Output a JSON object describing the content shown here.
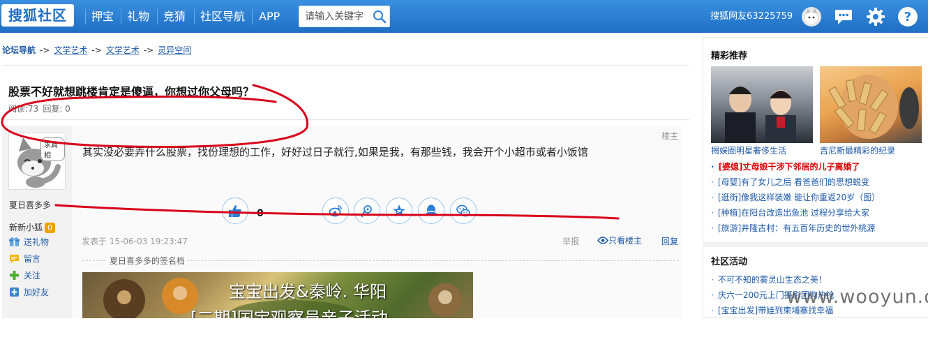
{
  "header": {
    "logo_text": "搜狐社区",
    "nav": [
      {
        "label": "押宝"
      },
      {
        "label": "礼物"
      },
      {
        "label": "竞猜"
      },
      {
        "label": "社区导航"
      },
      {
        "label": "APP"
      }
    ],
    "search_placeholder": "请输入关键字",
    "username": "搜狐网友63225759",
    "brand_color": "#2a7fd6"
  },
  "breadcrumb": {
    "home": "论坛导航",
    "sep": "->",
    "items": [
      "文学艺术",
      "文学艺术",
      "灵异空间"
    ]
  },
  "post": {
    "title": "股票不好就想跳楼肯定是傻逼，你想过你父母吗？",
    "reads_label": "阅读:73",
    "replies_label": "回复: 0",
    "floor_label": "楼主",
    "content": "其实没必要弄什么股票，找份理想的工作，好好过日子就行,如果是我，有那些钱，我会开个小超市或者小饭馆",
    "like_count": "0",
    "time": "发表于 15-06-03 19:23:47",
    "report": "举报",
    "only_op": "只看楼主",
    "reply": "回复",
    "signature_label": "夏日喜多多的签名档",
    "signature_image_line1": "宝宝出发&秦岭. 华阳",
    "signature_image_line2": "[二期]国宝观察员亲子活动"
  },
  "author": {
    "avatar_badge": "求真相",
    "name": "夏日喜多多",
    "level_label": "新新小狐",
    "level_num": "0",
    "actions": [
      {
        "label": "送礼物",
        "icon": "gift-icon"
      },
      {
        "label": "留言",
        "icon": "message-icon"
      },
      {
        "label": "关注",
        "icon": "plus-icon"
      },
      {
        "label": "加好友",
        "icon": "add-friend-icon"
      }
    ]
  },
  "sidebar": {
    "featured_title": "精彩推荐",
    "featured_images": [
      {
        "caption": "揭娱圈明星奢侈生活"
      },
      {
        "caption": "吉尼斯最精彩的纪录"
      }
    ],
    "featured_list": [
      {
        "text": "[婆媳]丈母娘干涉下邻居的儿子离婚了",
        "hot": true
      },
      {
        "text": "[母婴]有了女儿之后 看爸爸们的思想蜕变",
        "hot": false
      },
      {
        "text": "[逛街]像我这样装嫩 能让你重返20岁（图）",
        "hot": false
      },
      {
        "text": "[种植]在阳台改造出鱼池 过程分享给大家",
        "hot": false
      },
      {
        "text": "[旅游]井隆古村：有五百年历史的世外桃源",
        "hot": false
      }
    ],
    "activity_title": "社区活动",
    "activity_list": [
      {
        "text": "不可不知的雾灵山生态之美！"
      },
      {
        "text": "庆六一200元上门摄影团购热抢"
      },
      {
        "text": "[宝宝出发]带娃到柬埔寨找幸福"
      }
    ]
  },
  "watermark": "www.wooyun.org",
  "annotation_color": "#d8001a"
}
